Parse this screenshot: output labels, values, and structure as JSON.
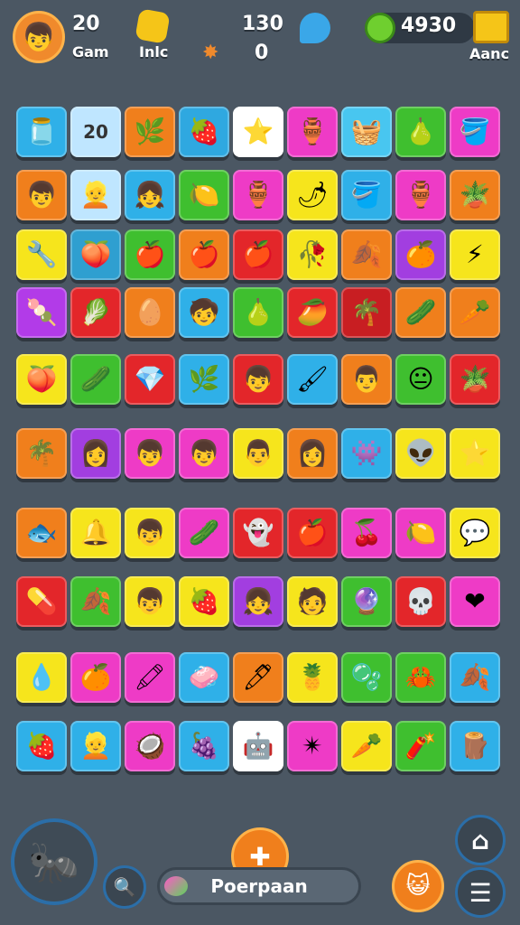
{
  "hud": {
    "level_value": "20",
    "level_label": "Gam",
    "gem_label": "Inlc",
    "score_value": "130",
    "score_sub": "0",
    "coins_value": "4930",
    "crate_label": "Aanc",
    "colors": {
      "gem": "#f5c518",
      "drop": "#3aa7e8",
      "coin": "#6fcf2f"
    }
  },
  "board": {
    "rows": [
      [
        {
          "c": "#2fb0e8",
          "g": "🫙"
        },
        {
          "c": "#bfe6ff",
          "g": "20"
        },
        {
          "c": "#f07f1c",
          "g": "🌿"
        },
        {
          "c": "#2fa8e0",
          "g": "🍓"
        },
        {
          "c": "#ffffff",
          "g": "⭐"
        },
        {
          "c": "#ee3bc6",
          "g": "🏺"
        },
        {
          "c": "#48c6f0",
          "g": "🧺"
        },
        {
          "c": "#3fbf2f",
          "g": "🍐"
        },
        {
          "c": "#ee3bc6",
          "g": "🪣"
        }
      ],
      [
        {
          "c": "#f07f1c",
          "g": "👦"
        },
        {
          "c": "#bfe6ff",
          "g": "👱"
        },
        {
          "c": "#2fb0e8",
          "g": "👧"
        },
        {
          "c": "#3fbf2f",
          "g": "🍋"
        },
        {
          "c": "#ee3bc6",
          "g": "🏺"
        },
        {
          "c": "#f6e51c",
          "g": "🌶"
        },
        {
          "c": "#2fb0e8",
          "g": "🪣"
        },
        {
          "c": "#ee3bc6",
          "g": "🏺"
        },
        {
          "c": "#f07f1c",
          "g": "🪴"
        }
      ],
      [
        {
          "c": "#f6e51c",
          "g": "🔧"
        },
        {
          "c": "#2f9fd0",
          "g": "🍑"
        },
        {
          "c": "#3fbf2f",
          "g": "🍎"
        },
        {
          "c": "#f07f1c",
          "g": "🍎"
        },
        {
          "c": "#e3262a",
          "g": "🍎"
        },
        {
          "c": "#f6e51c",
          "g": "🥀"
        },
        {
          "c": "#f07f1c",
          "g": "🍂"
        },
        {
          "c": "#a23ee0",
          "g": "🍊"
        },
        {
          "c": "#f6e51c",
          "g": "⚡"
        }
      ],
      [
        {
          "c": "#b23be8",
          "g": "🍡"
        },
        {
          "c": "#e3262a",
          "g": "🥬"
        },
        {
          "c": "#f07f1c",
          "g": "🥚"
        },
        {
          "c": "#2fb0e8",
          "g": "🧒"
        },
        {
          "c": "#3fbf2f",
          "g": "🍐"
        },
        {
          "c": "#e3262a",
          "g": "🥭"
        },
        {
          "c": "#c81e22",
          "g": "🌴"
        },
        {
          "c": "#f07f1c",
          "g": "🥒"
        },
        {
          "c": "#f07f1c",
          "g": "🥕"
        }
      ],
      [
        {
          "c": "#f6e51c",
          "g": "🍑"
        },
        {
          "c": "#3fbf2f",
          "g": "🥒"
        },
        {
          "c": "#e3262a",
          "g": "💎"
        },
        {
          "c": "#2fb0e8",
          "g": "🌿"
        },
        {
          "c": "#e3262a",
          "g": "👦"
        },
        {
          "c": "#2fb0e8",
          "g": "🖌"
        },
        {
          "c": "#f07f1c",
          "g": "👨"
        },
        {
          "c": "#3fbf2f",
          "g": "😐"
        },
        {
          "c": "#e3262a",
          "g": "🪴"
        }
      ],
      [
        {
          "c": "#f07f1c",
          "g": "🌴"
        },
        {
          "c": "#a23ee0",
          "g": "👩"
        },
        {
          "c": "#ee3bc6",
          "g": "👦"
        },
        {
          "c": "#ee3bc6",
          "g": "👦"
        },
        {
          "c": "#f6e51c",
          "g": "👨"
        },
        {
          "c": "#f07f1c",
          "g": "👩"
        },
        {
          "c": "#2fb0e8",
          "g": "👾"
        },
        {
          "c": "#f6e51c",
          "g": "👽"
        },
        {
          "c": "#f6e51c",
          "g": "⭐"
        }
      ],
      [
        {
          "c": "#f07f1c",
          "g": "🐟"
        },
        {
          "c": "#f6e51c",
          "g": "🔔"
        },
        {
          "c": "#f6e51c",
          "g": "👦"
        },
        {
          "c": "#ee3bc6",
          "g": "🥒"
        },
        {
          "c": "#e3262a",
          "g": "👻"
        },
        {
          "c": "#e3262a",
          "g": "🍎"
        },
        {
          "c": "#ee3bc6",
          "g": "🍒"
        },
        {
          "c": "#ee3bc6",
          "g": "🍋"
        },
        {
          "c": "#f6e51c",
          "g": "💬"
        }
      ],
      [
        {
          "c": "#e3262a",
          "g": "💊"
        },
        {
          "c": "#3fbf2f",
          "g": "🍂"
        },
        {
          "c": "#f6e51c",
          "g": "👦"
        },
        {
          "c": "#f6e51c",
          "g": "🍓"
        },
        {
          "c": "#a23ee0",
          "g": "👧"
        },
        {
          "c": "#f6e51c",
          "g": "🧑"
        },
        {
          "c": "#3fbf2f",
          "g": "🔮"
        },
        {
          "c": "#e3262a",
          "g": "💀"
        },
        {
          "c": "#ee3bc6",
          "g": "❤"
        }
      ],
      [
        {
          "c": "#f6e51c",
          "g": "💧"
        },
        {
          "c": "#ee3bc6",
          "g": "🍊"
        },
        {
          "c": "#ee3bc6",
          "g": "🖍"
        },
        {
          "c": "#2fb0e8",
          "g": "🧼"
        },
        {
          "c": "#f07f1c",
          "g": "🖊"
        },
        {
          "c": "#f6e51c",
          "g": "🍍"
        },
        {
          "c": "#3fbf2f",
          "g": "🫧"
        },
        {
          "c": "#3fbf2f",
          "g": "🦀"
        },
        {
          "c": "#2fb0e8",
          "g": "🍂"
        }
      ],
      [
        {
          "c": "#2fb0e8",
          "g": "🍓"
        },
        {
          "c": "#2fb0e8",
          "g": "👱"
        },
        {
          "c": "#ee3bc6",
          "g": "🥥"
        },
        {
          "c": "#2fb0e8",
          "g": "🍇"
        },
        {
          "c": "#ffffff",
          "g": "🤖"
        },
        {
          "c": "#ee3bc6",
          "g": "✴"
        },
        {
          "c": "#f6e51c",
          "g": "🥕"
        },
        {
          "c": "#3fbf2f",
          "g": "🧨"
        },
        {
          "c": "#2fb0e8",
          "g": "🪵"
        }
      ]
    ]
  },
  "bottom": {
    "search_label": "Poerpaan",
    "joystick_glyph": "🐜",
    "plus_glyph": "✚",
    "home_glyph": "⌂",
    "menu_glyph": "☰",
    "face_glyph": "😺",
    "magnifier_glyph": "🔍"
  }
}
